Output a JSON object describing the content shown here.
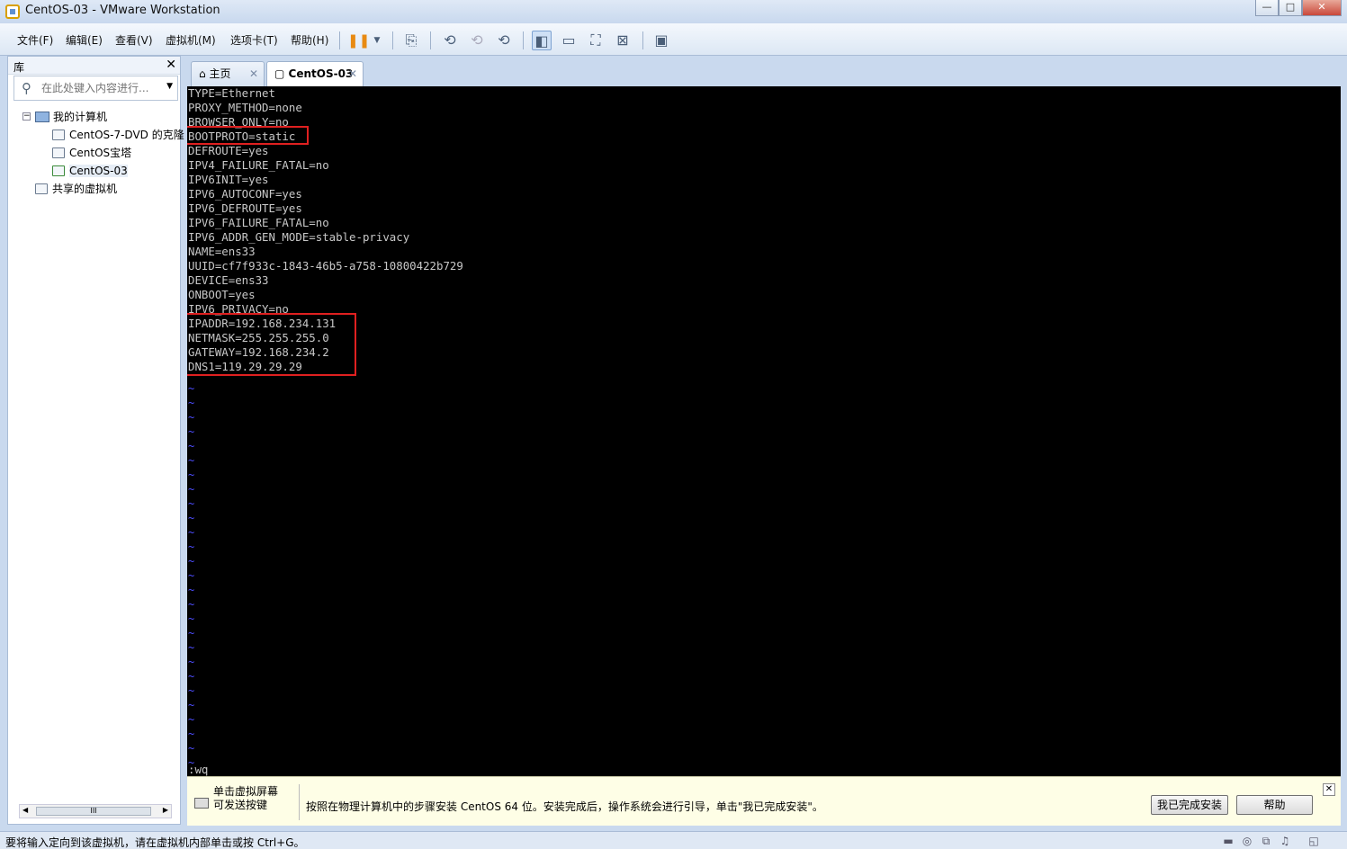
{
  "window": {
    "title": "CentOS-03 - VMware Workstation"
  },
  "menu": [
    "文件(F)",
    "编辑(E)",
    "查看(V)",
    "虚拟机(M)",
    "选项卡(T)",
    "帮助(H)"
  ],
  "library": {
    "title": "库",
    "search_placeholder": "在此处键入内容进行...",
    "root": "我的计算机",
    "vms": [
      "CentOS-7-DVD 的克隆",
      "CentOS宝塔",
      "CentOS-03"
    ],
    "shared": "共享的虚拟机"
  },
  "tabs": {
    "home": "主页",
    "vm": "CentOS-03"
  },
  "console": {
    "lines": [
      "TYPE=Ethernet",
      "PROXY_METHOD=none",
      "BROWSER_ONLY=no",
      "BOOTPROTO=static",
      "DEFROUTE=yes",
      "IPV4_FAILURE_FATAL=no",
      "IPV6INIT=yes",
      "IPV6_AUTOCONF=yes",
      "IPV6_DEFROUTE=yes",
      "IPV6_FAILURE_FATAL=no",
      "IPV6_ADDR_GEN_MODE=stable-privacy",
      "NAME=ens33",
      "UUID=cf7f933c-1843-46b5-a758-10800422b729",
      "DEVICE=ens33",
      "ONBOOT=yes",
      "IPV6_PRIVACY=no",
      "IPADDR=192.168.234.131",
      "NETMASK=255.255.255.0",
      "GATEWAY=192.168.234.2",
      "DNS1=119.29.29.29"
    ],
    "tilde": "~",
    "command": ":wq",
    "highlight_color": "#e02020",
    "tilde_color": "#4d4dff"
  },
  "hint": {
    "click_text": "单击虚拟屏幕\n可发送按键",
    "message": "按照在物理计算机中的步骤安装 CentOS 64 位。安装完成后，操作系统会进行引导，单击\"我已完成安装\"。",
    "done_button": "我已完成安装",
    "help_button": "帮助"
  },
  "status": {
    "text": "要将输入定向到该虚拟机，请在虚拟机内部单击或按 Ctrl+G。"
  }
}
